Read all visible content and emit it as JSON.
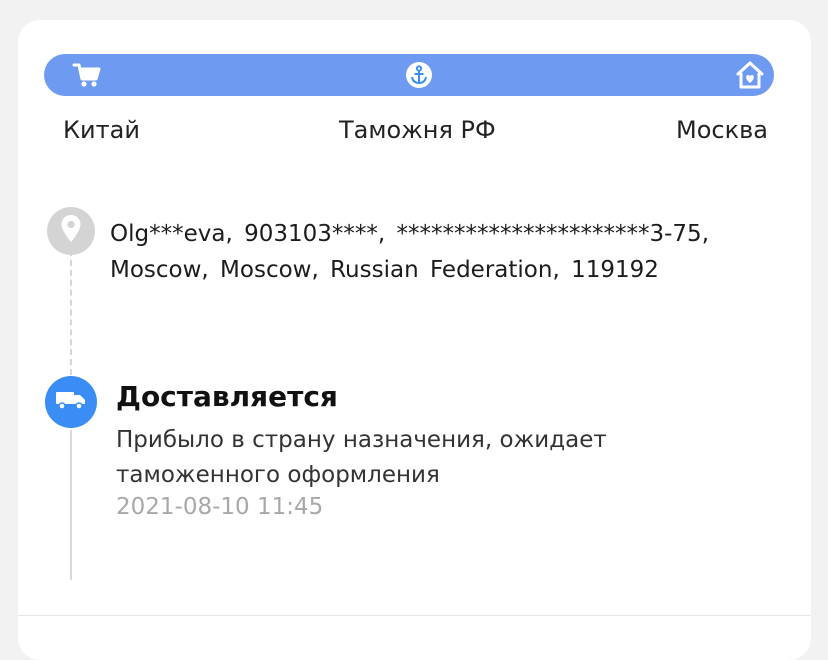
{
  "progress": {
    "accent_color": "#6e9bf1",
    "icons": [
      "cart-icon",
      "anchor-icon",
      "home-icon"
    ]
  },
  "stages": {
    "origin": "Китай",
    "customs": "Таможня РФ",
    "destination": "Москва"
  },
  "address": {
    "text": "Olg***eva, 903103****, **********************3-75, Moscow, Moscow, Russian Federation, 119192"
  },
  "event": {
    "title": "Доставляется",
    "description": "Прибыло в страну назначения, ожидает таможенного оформления",
    "timestamp": "2021-08-10 11:45",
    "marker_color": "#3a8df5",
    "icon": "truck-icon"
  }
}
